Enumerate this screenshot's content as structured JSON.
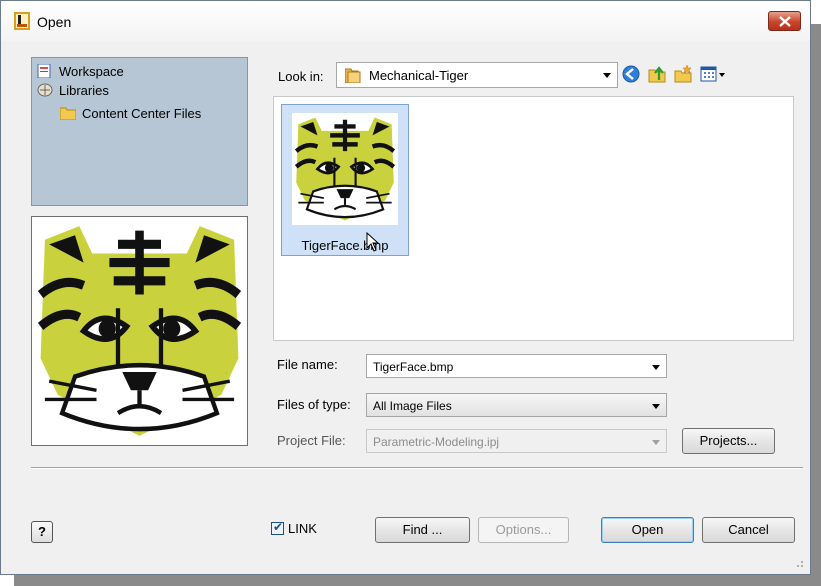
{
  "window": {
    "title": "Open"
  },
  "places": {
    "items": [
      {
        "label": "Workspace",
        "icon": "workspace-icon"
      },
      {
        "label": "Libraries",
        "icon": "libraries-icon"
      },
      {
        "label": "Content Center Files",
        "icon": "folder-icon"
      }
    ]
  },
  "lookin": {
    "label": "Look in:",
    "value": "Mechanical-Tiger"
  },
  "toolbar": {
    "icons": [
      "back-icon",
      "up-folder-icon",
      "new-folder-icon",
      "view-menu-icon"
    ]
  },
  "files": [
    {
      "name": "TigerFace.bmp"
    }
  ],
  "form": {
    "filename_label": "File name:",
    "filename_value": "TigerFace.bmp",
    "filetype_label": "Files of type:",
    "filetype_value": "All Image Files",
    "project_label": "Project File:",
    "project_value": "Parametric-Modeling.ipj",
    "projects_button": "Projects..."
  },
  "bottom": {
    "help": "?",
    "link_label": "LINK",
    "link_checked": true,
    "find_button": "Find ...",
    "options_button": "Options...",
    "open_button": "Open",
    "cancel_button": "Cancel"
  },
  "colors": {
    "tiger_yellow": "#c9d23c",
    "selection": "#cfe1f6",
    "places_bg": "#b7c6d4"
  }
}
